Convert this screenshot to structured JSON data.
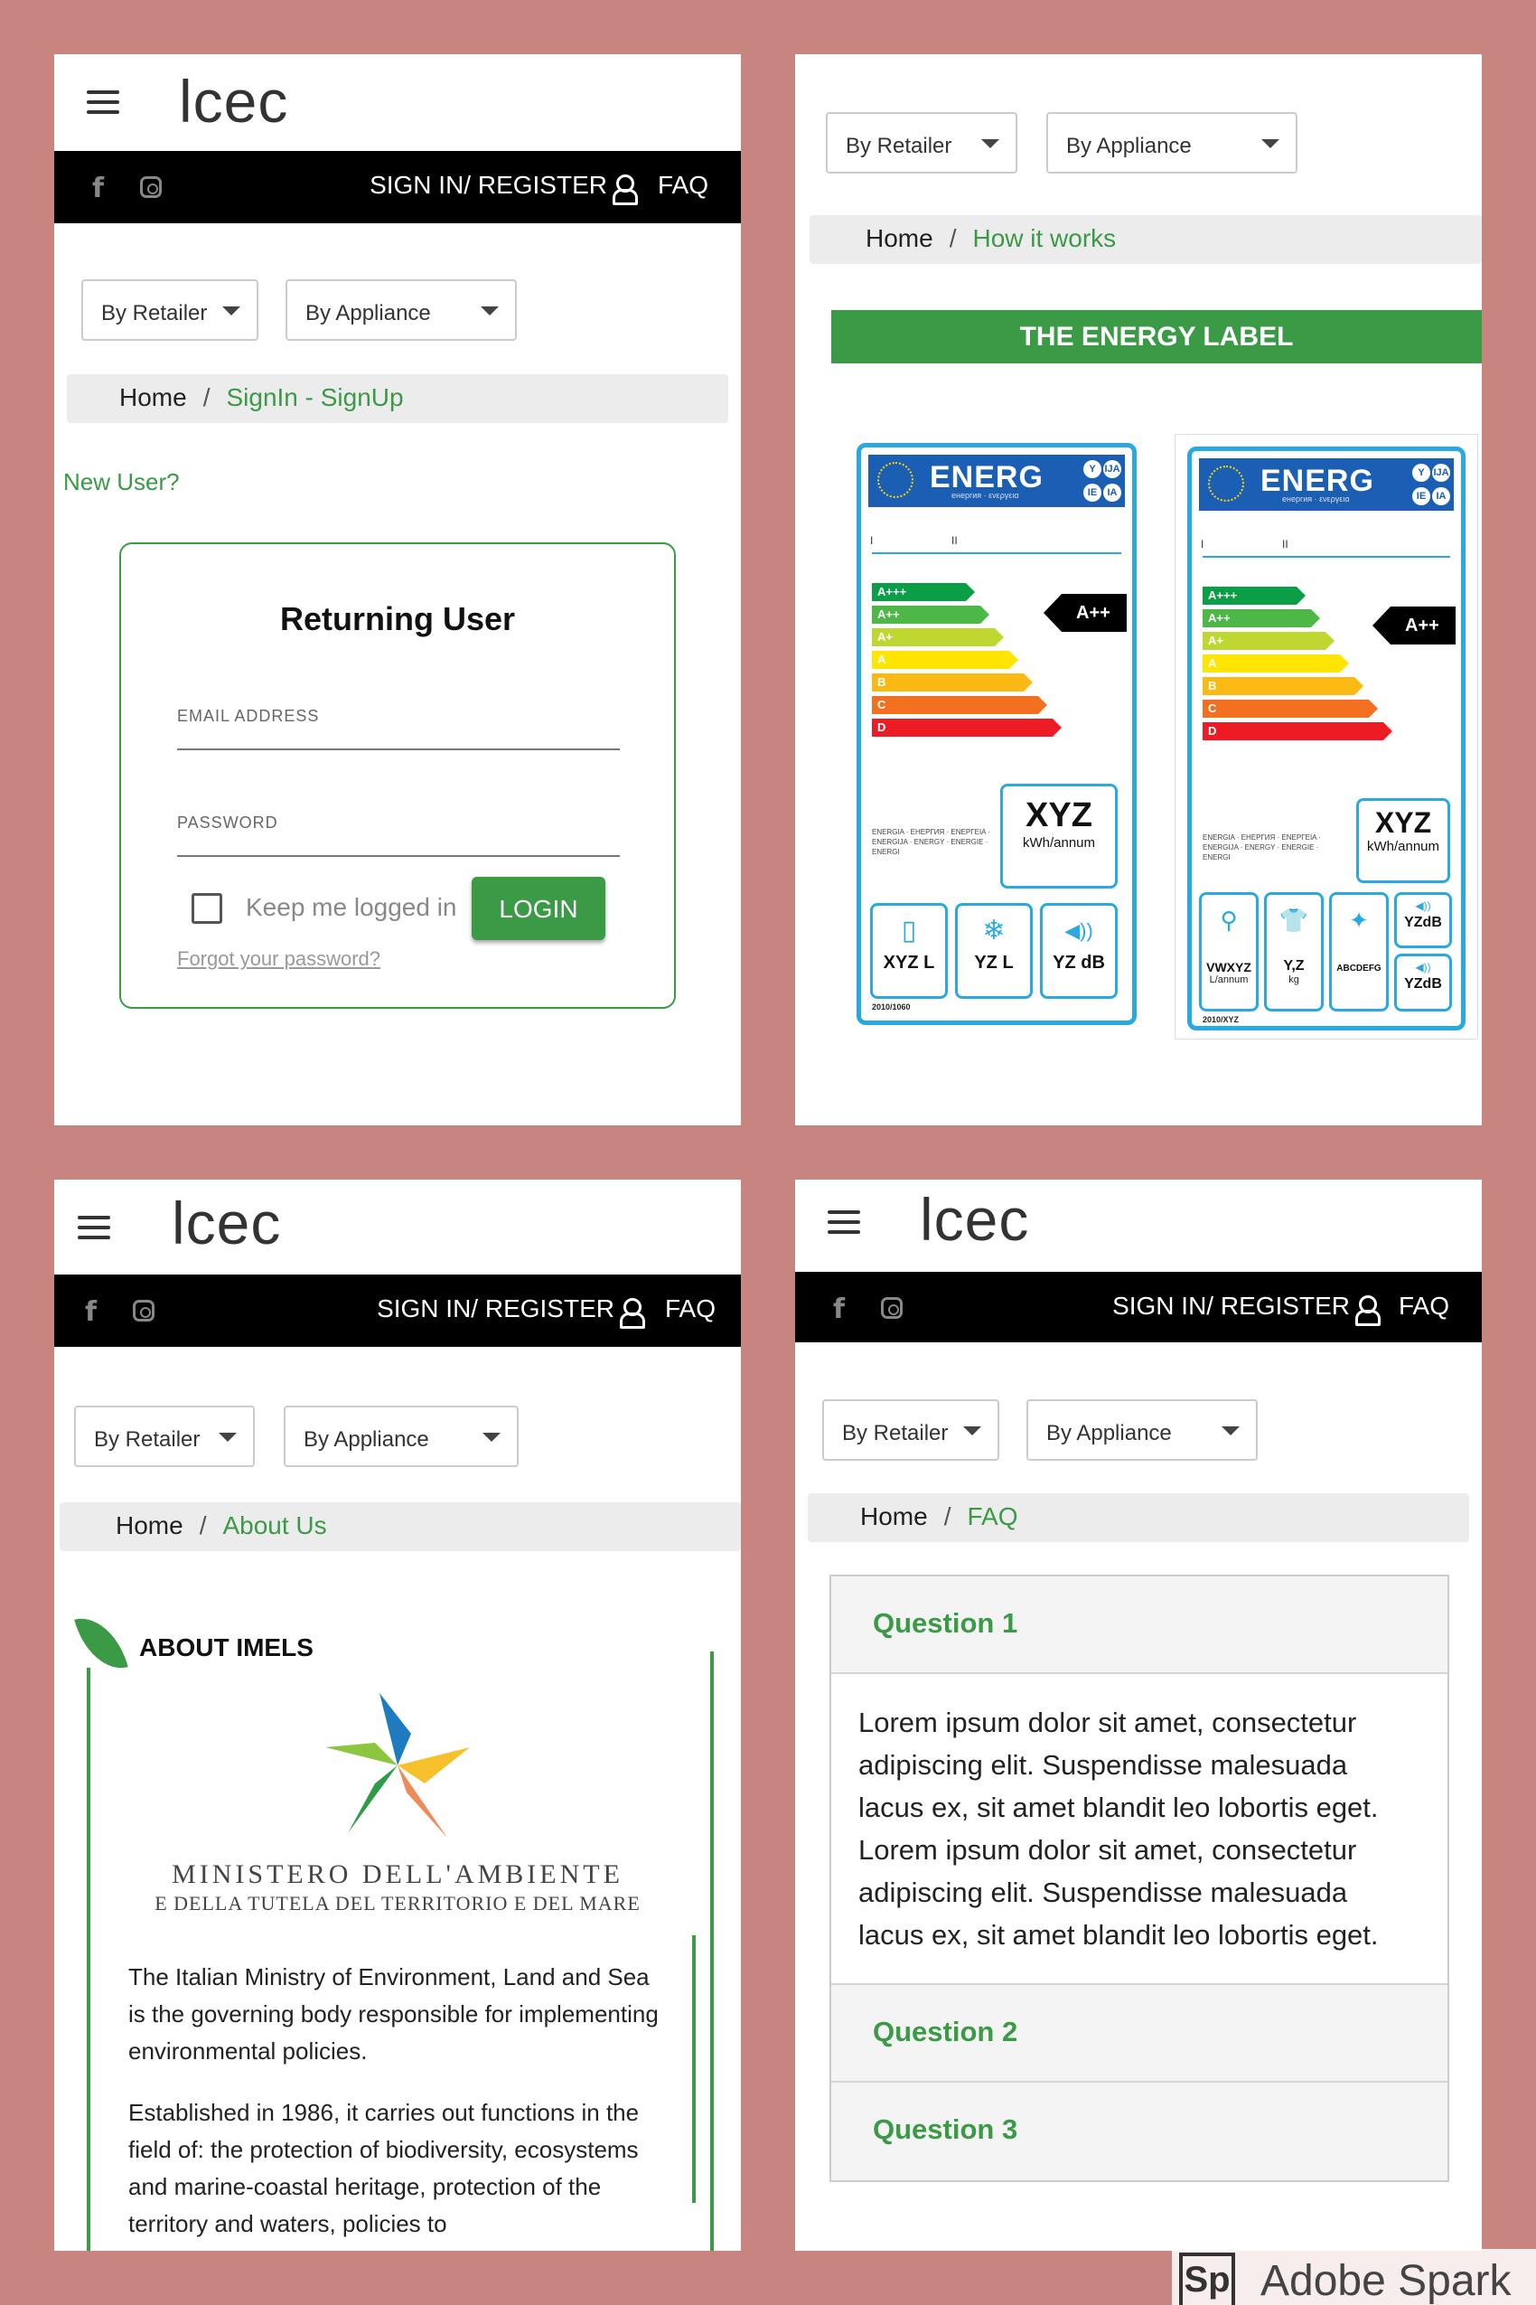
{
  "header": {
    "logo": "lcec",
    "signin_label": "SIGN IN/ REGISTER",
    "faq_label": "FAQ"
  },
  "filters": {
    "retailer": "By Retailer",
    "appliance": "By Appliance"
  },
  "breadcrumb": {
    "home": "Home",
    "separator": "/",
    "signin": "SignIn - SignUp",
    "how": "How it works",
    "about": "About Us",
    "faq": "FAQ"
  },
  "signin_page": {
    "new_user": "New User?",
    "returning_title": "Returning User",
    "email_label": "EMAIL ADDRESS",
    "password_label": "PASSWORD",
    "keep_logged": "Keep me logged in",
    "login_button": "LOGIN",
    "forgot": "Forgot your password?"
  },
  "how_page": {
    "banner": "THE ENERGY LABEL",
    "label1": {
      "title": "ENERG",
      "sub": "енергия · ενεργεια",
      "classes": [
        "A+++",
        "A++",
        "A+",
        "A",
        "B",
        "C",
        "D"
      ],
      "rating": "A++",
      "consumption": "XYZ",
      "consumption_unit": "kWh/annum",
      "langs": "ENERGIA · ЕНЕРГИЯ · ΕΝΕΡΓΕΙΑ · ENERGIJA · ENERGY · ENERGIE · ENERGI",
      "icons": [
        {
          "icon": "fridge-icon",
          "symbol": "▯",
          "value": "XYZ L"
        },
        {
          "icon": "snowflake-icon",
          "symbol": "❄",
          "value": "YZ L"
        },
        {
          "icon": "sound-icon",
          "symbol": "◀))",
          "value": "YZ dB"
        }
      ],
      "regulation": "2010/1060"
    },
    "label2": {
      "title": "ENERG",
      "sub": "енергия · ενεργεια",
      "classes": [
        "A+++",
        "A++",
        "A+",
        "A",
        "B",
        "C",
        "D"
      ],
      "rating": "A++",
      "consumption": "XYZ",
      "consumption_unit": "kWh/annum",
      "langs": "ENERGIA · ЕНЕРГИЯ · ΕΝΕΡΓΕΙΑ · ENERGIJA · ENERGY · ENERGIE · ENERGI",
      "icons": [
        {
          "icon": "tap-icon",
          "symbol": "⚲",
          "value": "VWXYZ",
          "unit": "L/annum"
        },
        {
          "icon": "shirt-icon",
          "symbol": "👕",
          "value": "Y,Z",
          "unit": "kg"
        },
        {
          "icon": "spin-icon",
          "symbol": "✦",
          "value": "ABCDEFG"
        },
        {
          "icon": "sound-icon",
          "symbol": "◀))",
          "value": "YZdB",
          "value2": "YZdB"
        }
      ],
      "regulation": "2010/XYZ"
    }
  },
  "about_page": {
    "title": "ABOUT IMELS",
    "ministry_line1": "MINISTERO DELL'AMBIENTE",
    "ministry_line2": "E DELLA TUTELA DEL TERRITORIO E DEL MARE",
    "paragraph1": "The Italian Ministry of Environment, Land and Sea is the governing body responsible for implementing environmental policies.",
    "paragraph2": "Established in 1986, it carries out functions in the field of: the protection of biodiversity, ecosystems and marine-coastal heritage, protection of the territory and waters, policies to"
  },
  "faq_page": {
    "questions": [
      {
        "title": "Question 1",
        "answer": "Lorem ipsum dolor sit amet, consectetur adipiscing elit. Suspendisse malesuada lacus ex, sit amet blandit leo lobortis eget. Lorem ipsum dolor sit amet, consectetur adipiscing elit. Suspendisse malesuada lacus ex, sit amet blandit leo lobortis eget."
      },
      {
        "title": "Question 2"
      },
      {
        "title": "Question 3"
      }
    ]
  },
  "watermark": {
    "icon_text": "Sp",
    "text": "Adobe Spark"
  },
  "colors": {
    "background": "#c8847f",
    "accent_green": "#3a9a46",
    "label_blue": "#2aa9e0"
  }
}
